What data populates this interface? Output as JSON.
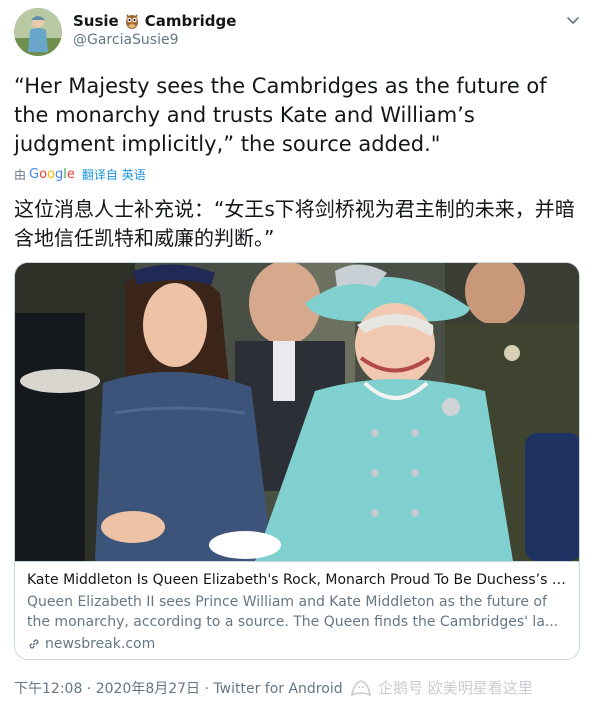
{
  "header": {
    "name_first": "Susie",
    "name_last": "Cambridge",
    "handle": "@GarciaSusie9"
  },
  "tweet": {
    "text": "“Her Majesty sees the Cambridges as the future of the monarchy and trusts Kate and William’s judgment implicitly,” the source added.\"",
    "translate_by": "由",
    "google_letters": [
      "G",
      "o",
      "o",
      "g",
      "l",
      "e"
    ],
    "translate_from": "翻译自",
    "translate_lang": "英语",
    "translated_text": "这位消息人士补充说：“女王s下将剑桥视为君主制的未来，并暗含地信任凯特和威廉的判断。”"
  },
  "card": {
    "title": "Kate Middleton Is Queen Elizabeth's Rock, Monarch Proud To Be Duchess’s Grandmother-In-Law",
    "description": "Queen Elizabeth II sees Prince William and Kate Middleton as the future of the monarchy, according to a source. The Queen finds the Cambridges' la...",
    "domain": "newsbreak.com"
  },
  "footer": {
    "meta": "下午12:08 · 2020年8月27日 · Twitter for Android",
    "watermark": "企鹅号 欧美明星看这里"
  },
  "icons": {
    "owl": "owl-emoji-icon",
    "chevron": "chevron-down-icon",
    "link": "link-icon",
    "watermark": "penguin-icon"
  },
  "colors": {
    "text": "#14171a",
    "secondary": "#657786",
    "link": "#1b95e0",
    "border": "#ccd6dd",
    "queen_outfit": "#7fd0cf"
  }
}
